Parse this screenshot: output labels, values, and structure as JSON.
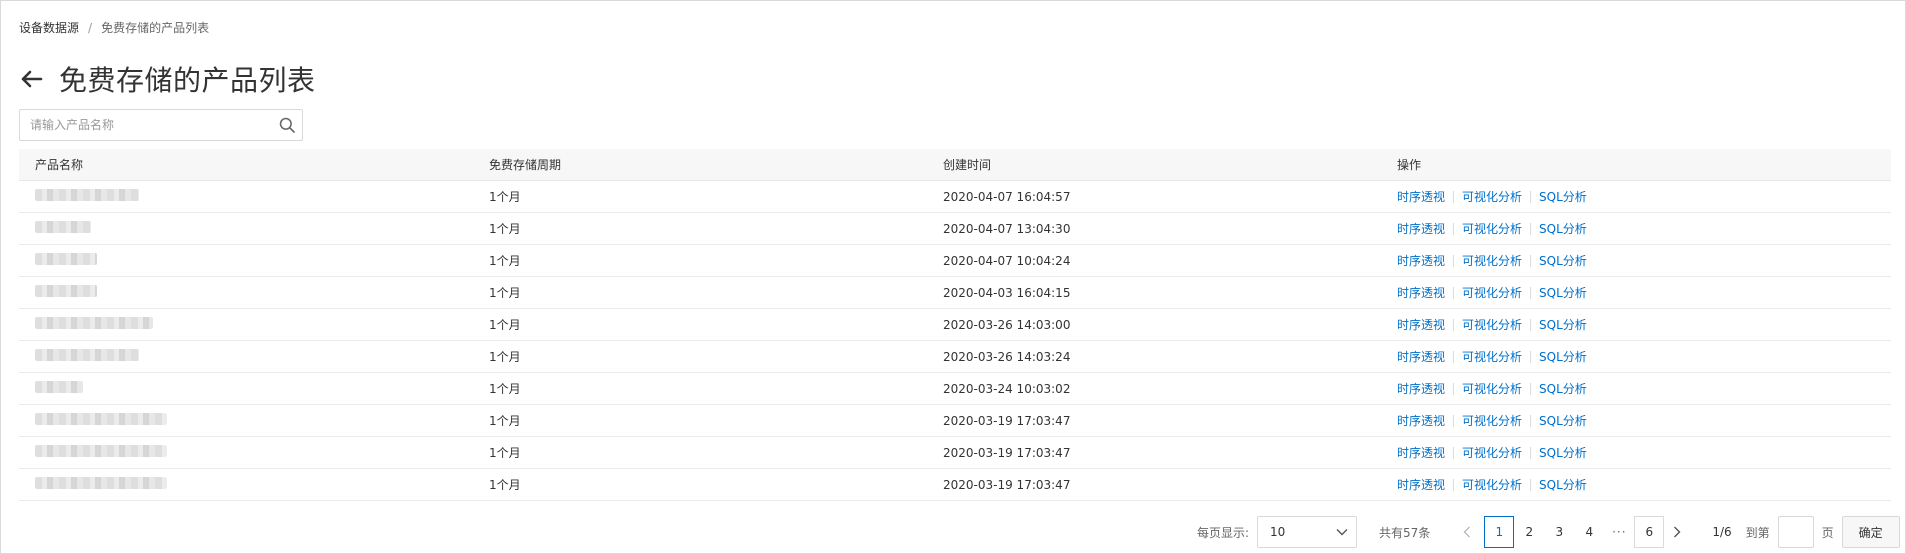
{
  "breadcrumb": {
    "parent": "设备数据源",
    "separator": "/",
    "current": "免费存储的产品列表"
  },
  "header": {
    "back_icon": "arrow-left-icon",
    "title": "免费存储的产品列表"
  },
  "search": {
    "placeholder": "请输入产品名称",
    "value": "",
    "icon": "search-icon"
  },
  "table": {
    "columns": [
      "产品名称",
      "免费存储周期",
      "创建时间",
      "操作"
    ],
    "rows": [
      {
        "period": "1个月",
        "created": "2020-04-07 16:04:57"
      },
      {
        "period": "1个月",
        "created": "2020-04-07 13:04:30"
      },
      {
        "period": "1个月",
        "created": "2020-04-07 10:04:24"
      },
      {
        "period": "1个月",
        "created": "2020-04-03 16:04:15"
      },
      {
        "period": "1个月",
        "created": "2020-03-26 14:03:00"
      },
      {
        "period": "1个月",
        "created": "2020-03-26 14:03:24"
      },
      {
        "period": "1个月",
        "created": "2020-03-24 10:03:02"
      },
      {
        "period": "1个月",
        "created": "2020-03-19 17:03:47"
      },
      {
        "period": "1个月",
        "created": "2020-03-19 17:03:47"
      },
      {
        "period": "1个月",
        "created": "2020-03-19 17:03:47"
      }
    ],
    "actions": [
      "时序透视",
      "可视化分析",
      "SQL分析"
    ]
  },
  "pagination": {
    "per_page_label": "每页显示:",
    "per_page_value": "10",
    "total_label": "共有57条",
    "pages": [
      "1",
      "2",
      "3",
      "4"
    ],
    "ellipsis": "···",
    "last_page": "6",
    "current_page": "1",
    "ratio": "1/6",
    "goto_label": "到第",
    "page_unit": "页",
    "confirm_label": "确定"
  },
  "colors": {
    "link": "#0070cc",
    "header_bg": "#f7f7f7",
    "border": "#d9d9d9"
  }
}
